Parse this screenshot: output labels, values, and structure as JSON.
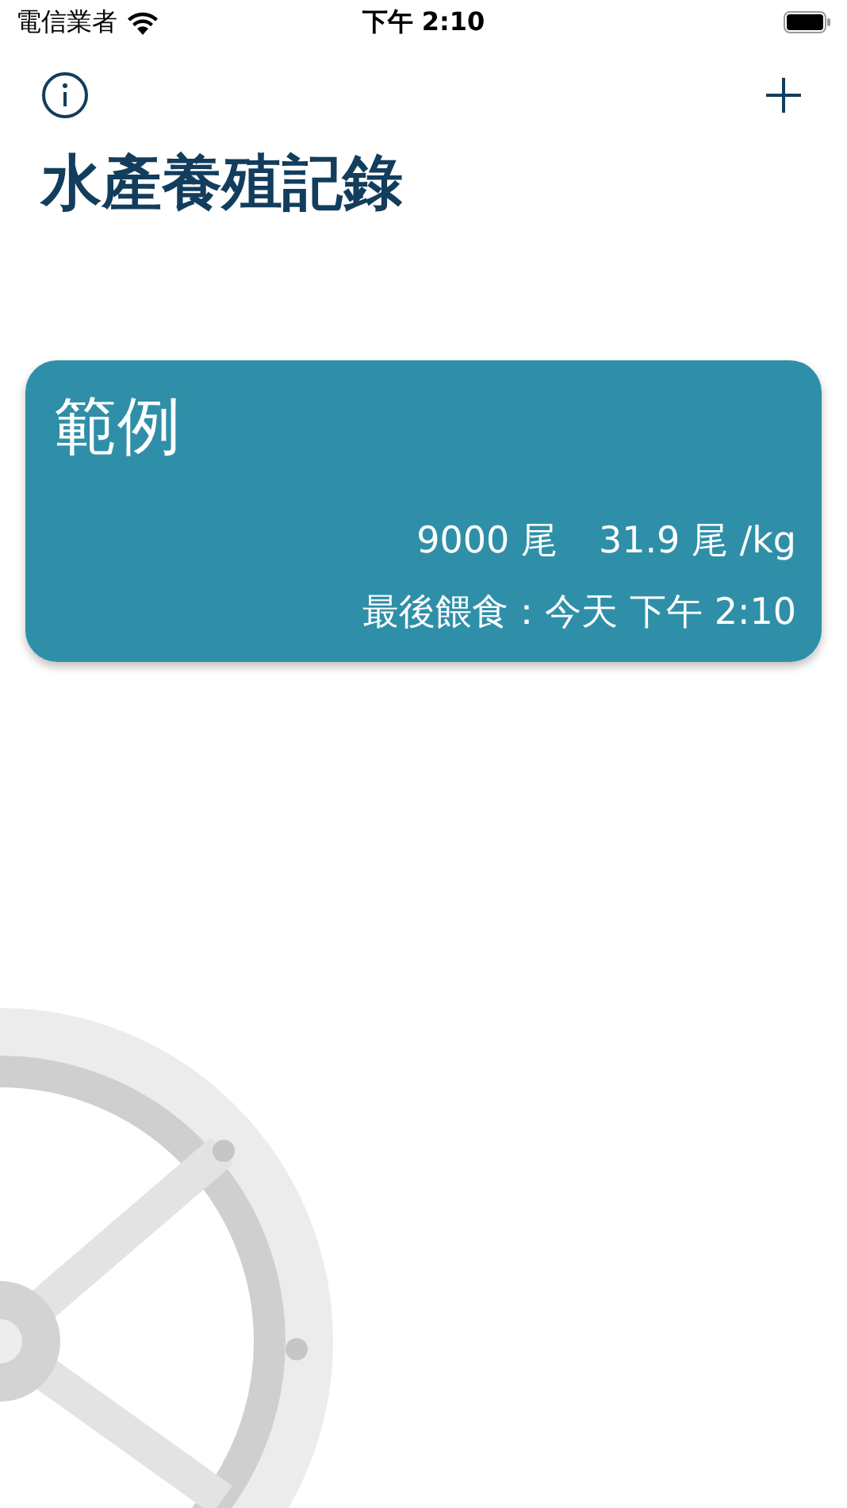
{
  "status_bar": {
    "carrier": "電信業者",
    "time": "下午 2:10"
  },
  "title": "水產養殖記錄",
  "records": [
    {
      "name": "範例",
      "count": "9000 尾",
      "per_kg": "31.9 尾 /kg",
      "last_fed": "最後餵食：今天 下午 2:10"
    }
  ]
}
